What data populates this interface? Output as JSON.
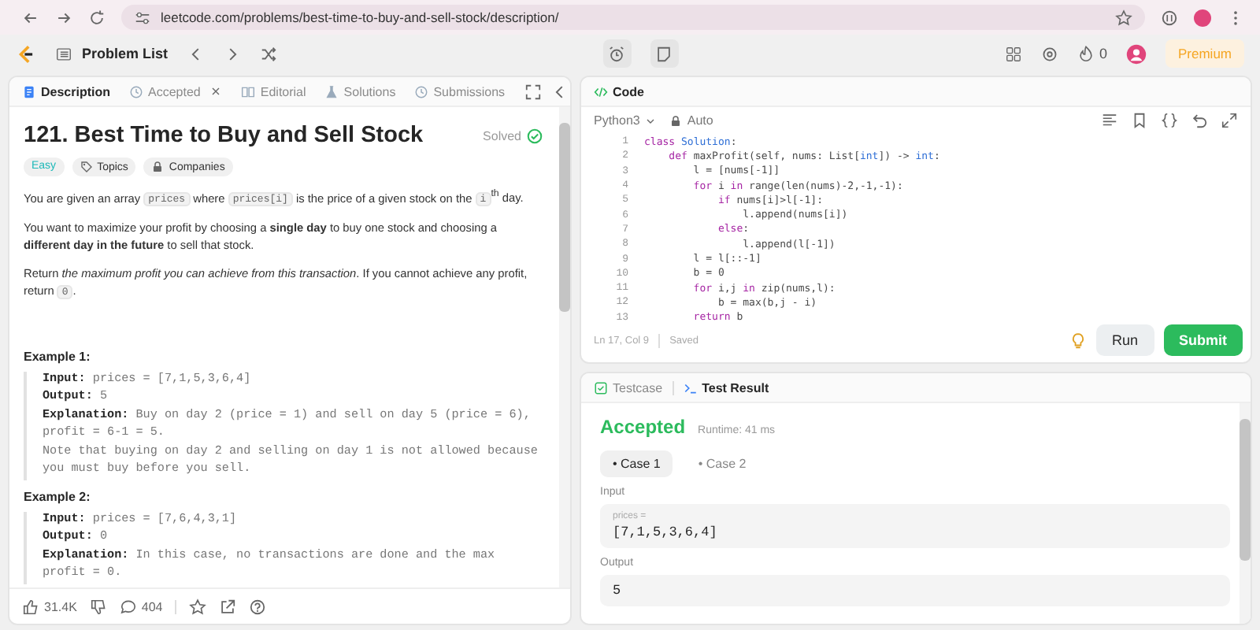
{
  "browser": {
    "url": "leetcode.com/problems/best-time-to-buy-and-sell-stock/description/"
  },
  "header": {
    "problem_list": "Problem List",
    "streak": "0",
    "premium": "Premium"
  },
  "description_panel": {
    "tabs": [
      {
        "label": "Description",
        "kind": "document",
        "selected": true,
        "closable": false
      },
      {
        "label": "Accepted",
        "kind": "clock",
        "selected": false,
        "closable": true
      },
      {
        "label": "Editorial",
        "kind": "book",
        "selected": false,
        "closable": false
      },
      {
        "label": "Solutions",
        "kind": "flask",
        "selected": false,
        "closable": false
      },
      {
        "label": "Submissions",
        "kind": "clock",
        "selected": false,
        "closable": false
      }
    ],
    "title": "121. Best Time to Buy and Sell Stock",
    "status": "Solved",
    "difficulty": "Easy",
    "tags": [
      {
        "label": "Topics",
        "kind": "tag"
      },
      {
        "label": "Companies",
        "kind": "lock"
      }
    ],
    "paragraphs": [
      [
        {
          "kind": "text",
          "text": "You are given an array "
        },
        {
          "kind": "code",
          "text": "prices"
        },
        {
          "kind": "text",
          "text": " where "
        },
        {
          "kind": "code",
          "text": "prices[i]"
        },
        {
          "kind": "text",
          "text": " is the price of a given stock on the "
        },
        {
          "kind": "code",
          "text": "i"
        },
        {
          "kind": "text",
          "text": "$^{th}$ day."
        }
      ],
      [
        {
          "kind": "text",
          "text": "You want to maximize your profit by choosing a **single day** to buy one stock and choosing a **different day in the future** to sell that stock."
        }
      ],
      [
        {
          "kind": "text",
          "text": "Return *the maximum profit you can achieve from this transaction*. If you cannot achieve any profit, return "
        },
        {
          "kind": "code",
          "text": "0"
        },
        {
          "kind": "text",
          "text": "."
        }
      ]
    ],
    "examples": [
      {
        "title": "Example 1:",
        "lines": [
          {
            "label": "Input:",
            "text": " prices = [7,1,5,3,6,4]"
          },
          {
            "label": "Output:",
            "text": " 5"
          },
          {
            "label": "Explanation:",
            "text": " Buy on day 2 (price = 1) and sell on day 5 (price = 6), profit = 6-1 = 5."
          },
          {
            "text": "Note that buying on day 2 and selling on day 1 is not allowed because you must buy before you sell."
          }
        ]
      },
      {
        "title": "Example 2:",
        "lines": [
          {
            "label": "Input:",
            "text": " prices = [7,6,4,3,1]"
          },
          {
            "label": "Output:",
            "text": " 0"
          },
          {
            "label": "Explanation:",
            "text": " In this case, no transactions are done and the max profit = 0."
          }
        ]
      }
    ],
    "footer": {
      "likes": "31.4K",
      "comments": "404"
    }
  },
  "code_panel": {
    "tab": "Code",
    "language": "Python3",
    "mode": "Auto",
    "lines": [
      {
        "number": "1",
        "tokens": [
          {
            "kind": "kw",
            "text": "class"
          },
          {
            "kind": "type",
            "text": " Solution"
          },
          {
            "kind": "plain",
            "text": ":"
          }
        ]
      },
      {
        "number": "2",
        "tokens": [
          {
            "kind": "kw",
            "text": "    def"
          },
          {
            "kind": "plain",
            "text": " maxProfit(self, nums: List["
          },
          {
            "kind": "type",
            "text": "int"
          },
          {
            "kind": "plain",
            "text": "]) -> "
          },
          {
            "kind": "type",
            "text": "int"
          },
          {
            "kind": "plain",
            "text": ":"
          }
        ]
      },
      {
        "number": "3",
        "tokens": [
          {
            "kind": "plain",
            "text": "        l = [nums[-1]]"
          }
        ]
      },
      {
        "number": "4",
        "tokens": [
          {
            "kind": "kw",
            "text": "        for"
          },
          {
            "kind": "plain",
            "text": " i "
          },
          {
            "kind": "kw",
            "text": "in"
          },
          {
            "kind": "plain",
            "text": " range(len(nums)-2,-1,-1):"
          }
        ]
      },
      {
        "number": "5",
        "tokens": [
          {
            "kind": "kw",
            "text": "            if"
          },
          {
            "kind": "plain",
            "text": " nums[i]>l[-1]:"
          }
        ]
      },
      {
        "number": "6",
        "tokens": [
          {
            "kind": "plain",
            "text": "                l.append(nums[i])"
          }
        ]
      },
      {
        "number": "7",
        "tokens": [
          {
            "kind": "kw",
            "text": "            else"
          },
          {
            "kind": "plain",
            "text": ":"
          }
        ]
      },
      {
        "number": "8",
        "tokens": [
          {
            "kind": "plain",
            "text": "                l.append(l[-1])"
          }
        ]
      },
      {
        "number": "9",
        "tokens": [
          {
            "kind": "plain",
            "text": "        l = l[::-1]"
          }
        ]
      },
      {
        "number": "10",
        "tokens": [
          {
            "kind": "plain",
            "text": "        b = 0"
          }
        ]
      },
      {
        "number": "11",
        "tokens": [
          {
            "kind": "kw",
            "text": "        for"
          },
          {
            "kind": "plain",
            "text": " i,j "
          },
          {
            "kind": "kw",
            "text": "in"
          },
          {
            "kind": "plain",
            "text": " zip(nums,l):"
          }
        ]
      },
      {
        "number": "12",
        "tokens": [
          {
            "kind": "plain",
            "text": "            b = max(b,j - i)"
          }
        ]
      },
      {
        "number": "13",
        "tokens": [
          {
            "kind": "kw",
            "text": "        return"
          },
          {
            "kind": "plain",
            "text": " b"
          }
        ]
      }
    ],
    "position": "Ln 17, Col 9",
    "save_state": "Saved",
    "run": "Run",
    "submit": "Submit"
  },
  "result_panel": {
    "tabs": [
      {
        "label": "Testcase",
        "kind": "check",
        "selected": false
      },
      {
        "label": "Test Result",
        "kind": "terminal",
        "selected": true
      }
    ],
    "verdict": "Accepted",
    "runtime": "Runtime: 41 ms",
    "cases": [
      {
        "label": "• Case 1",
        "selected": true
      },
      {
        "label": "• Case 2",
        "selected": false
      }
    ],
    "input_label": "Input",
    "input_name": "prices =",
    "input_value": "[7,1,5,3,6,4]",
    "output_label": "Output",
    "output_value": "5"
  }
}
